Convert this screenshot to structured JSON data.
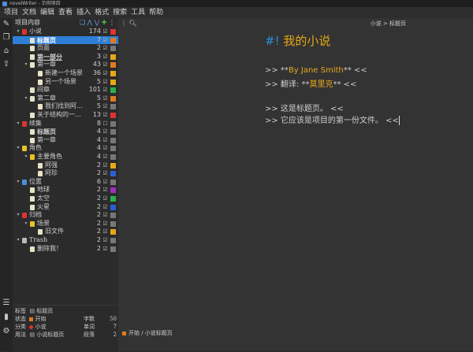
{
  "window": {
    "title": "novelWriter - 示例项目"
  },
  "menu": [
    "项目",
    "文档",
    "编辑",
    "查看",
    "插入",
    "格式",
    "搜索",
    "工具",
    "帮助"
  ],
  "sidebar_icons": [
    "edit-icon",
    "copy-icon",
    "home-icon",
    "export-icon"
  ],
  "sidebar_bottom_icons": [
    "list-icon",
    "stats-icon",
    "gear-icon"
  ],
  "tree": {
    "header": "项目内容",
    "rows": [
      {
        "label": "小说",
        "count": "174",
        "level": 0,
        "arrow": "▾",
        "icon": "#d33",
        "sq": "#d33",
        "chk": "☑"
      },
      {
        "label": "标题页",
        "count": "7",
        "level": 1,
        "arrow": "",
        "icon": "#e8e2c8",
        "sq": "#e07a1f",
        "chk": "☑",
        "sel": true,
        "bold": true
      },
      {
        "label": "页面",
        "count": "2",
        "level": 1,
        "arrow": "",
        "icon": "#e8e2c8",
        "sq": "#777",
        "chk": "☑"
      },
      {
        "label": "第一部分",
        "count": "3",
        "level": 1,
        "arrow": "",
        "icon": "#e8e2c8",
        "sq": "#e6a817",
        "chk": "☑",
        "bold": true,
        "under": true
      },
      {
        "label": "第一章",
        "count": "43",
        "level": 1,
        "arrow": "▾",
        "icon": "#e8e2c8",
        "sq": "#e07a1f",
        "chk": "☑"
      },
      {
        "label": "新建一个场景",
        "count": "36",
        "level": 2,
        "arrow": "",
        "icon": "#e8e2c8",
        "sq": "#e6a817",
        "chk": "☑"
      },
      {
        "label": "另一个场景",
        "count": "5",
        "level": 2,
        "arrow": "",
        "icon": "#e8e2c8",
        "sq": "#e6a817",
        "chk": "☑"
      },
      {
        "label": "间章",
        "count": "101",
        "level": 1,
        "arrow": "",
        "icon": "#e8e2c8",
        "sq": "#2bb24c",
        "chk": "☑"
      },
      {
        "label": "第二章",
        "count": "5",
        "level": 1,
        "arrow": "▾",
        "icon": "#e8e2c8",
        "sq": "#e07a1f",
        "chk": "☑"
      },
      {
        "label": "我们找到阿…",
        "count": "5",
        "level": 2,
        "arrow": "",
        "icon": "#e8e2c8",
        "sq": "#777",
        "chk": "☑"
      },
      {
        "label": "关于结构的一…",
        "count": "13",
        "level": 1,
        "arrow": "",
        "icon": "#e8e2c8",
        "sq": "#d33",
        "chk": "☑"
      },
      {
        "label": "续集",
        "count": "8",
        "level": 0,
        "arrow": "▾",
        "icon": "#d33",
        "sq": "#777",
        "chk": "☐"
      },
      {
        "label": "标题页",
        "count": "4",
        "level": 1,
        "arrow": "",
        "icon": "#e8e2c8",
        "sq": "#777",
        "chk": "☑",
        "bold": true
      },
      {
        "label": "第一章",
        "count": "4",
        "level": 1,
        "arrow": "",
        "icon": "#e8e2c8",
        "sq": "#777",
        "chk": "☑"
      },
      {
        "label": "角色",
        "count": "4",
        "level": 0,
        "arrow": "▾",
        "icon": "#e6c229",
        "sq": "#777",
        "chk": "☑"
      },
      {
        "label": "主要角色",
        "count": "4",
        "level": 1,
        "arrow": "▾",
        "icon": "#e6c229",
        "sq": "#777",
        "chk": "☑"
      },
      {
        "label": "阿强",
        "count": "2",
        "level": 2,
        "arrow": "",
        "icon": "#e8e2c8",
        "sq": "#e6a817",
        "chk": "☑"
      },
      {
        "label": "阿珍",
        "count": "2",
        "level": 2,
        "arrow": "",
        "icon": "#e8e2c8",
        "sq": "#2b5fd6",
        "chk": "☑"
      },
      {
        "label": "位置",
        "count": "6",
        "level": 0,
        "arrow": "▾",
        "icon": "#4a90d9",
        "sq": "#777",
        "chk": "☑"
      },
      {
        "label": "地球",
        "count": "2",
        "level": 1,
        "arrow": "",
        "icon": "#e8e2c8",
        "sq": "#a030c0",
        "chk": "☑"
      },
      {
        "label": "太空",
        "count": "2",
        "level": 1,
        "arrow": "",
        "icon": "#e8e2c8",
        "sq": "#2bb24c",
        "chk": "☑"
      },
      {
        "label": "火星",
        "count": "2",
        "level": 1,
        "arrow": "",
        "icon": "#e8e2c8",
        "sq": "#2b5fd6",
        "chk": "☑"
      },
      {
        "label": "归档",
        "count": "2",
        "level": 0,
        "arrow": "▾",
        "icon": "#d33",
        "sq": "#777",
        "chk": "☑"
      },
      {
        "label": "场景",
        "count": "2",
        "level": 1,
        "arrow": "▾",
        "icon": "#e6c229",
        "sq": "#777",
        "chk": "☑"
      },
      {
        "label": "旧文件",
        "count": "2",
        "level": 2,
        "arrow": "",
        "icon": "#e8e2c8",
        "sq": "#e6a817",
        "chk": "☑"
      },
      {
        "label": "Trash",
        "count": "2",
        "level": 0,
        "arrow": "▾",
        "icon": "#bbb",
        "sq": "#777",
        "chk": "☑"
      },
      {
        "label": "删除我！",
        "count": "2",
        "level": 1,
        "arrow": "",
        "icon": "#e8e2c8",
        "sq": "#777",
        "chk": "☑"
      }
    ]
  },
  "meta": {
    "tag_label": "标签",
    "tag_value": "标题页",
    "status_label": "状态",
    "status_value": "开始",
    "class_label": "分类",
    "class_value": "小说",
    "usage_label": "用法",
    "usage_value": "小说标题页",
    "chars_label": "字数",
    "chars_value": "50",
    "words_label": "单词",
    "words_value": "7",
    "paras_label": "段落",
    "paras_value": "2",
    "colors": {
      "status": "#e07a1f",
      "class": "#d33"
    }
  },
  "editor": {
    "breadcrumb": "小说  >  标题页",
    "heading_mark": "#!",
    "heading_text": "我的小说",
    "lines": [
      {
        "pre": ">> **",
        "main": "By Jane Smith",
        "post": "** <<"
      },
      {
        "pre": ">> 翻译: **",
        "main": "莫里克",
        "post": "** <<"
      },
      {
        "pre": ">> 这是标题页。 <<",
        "main": "",
        "post": ""
      },
      {
        "pre": ">> 它应该是项目的第一份文件。 <<",
        "main": "",
        "post": ""
      }
    ],
    "colors": {
      "heading": "#e6a817",
      "mark": "#2d8fd6",
      "accent": "#e6a817",
      "text": "#cfcfcf"
    }
  },
  "statusbar": {
    "label": "开始 / 小说标题页"
  }
}
